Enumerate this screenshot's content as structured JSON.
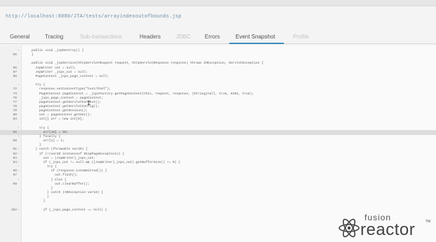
{
  "url": "http://localhost:8080/JTA/tests/arrayindexoutofbounds.jsp",
  "tabs": [
    {
      "label": "General",
      "state": "normal"
    },
    {
      "label": "Tracing",
      "state": "normal"
    },
    {
      "label": "Sub-transactions",
      "state": "disabled"
    },
    {
      "label": "Headers",
      "state": "normal"
    },
    {
      "label": "JDBC",
      "state": "disabled"
    },
    {
      "label": "Errors",
      "state": "normal"
    },
    {
      "label": "Event Snapshot",
      "state": "active"
    },
    {
      "label": "Profile",
      "state": "disabled"
    }
  ],
  "code_lines": [
    {
      "ln": "",
      "fold": "–",
      "text": "    public void _jspDestroy() {"
    },
    {
      "ln": "56",
      "fold": "",
      "text": "    }"
    },
    {
      "ln": "",
      "fold": "",
      "text": ""
    },
    {
      "ln": "",
      "fold": "–",
      "text": "    public void _jspService(HttpServletRequest request, HttpServletResponse response) throws IOException, ServletException {"
    },
    {
      "ln": "65",
      "fold": "",
      "text": "      JspWriter out = null;"
    },
    {
      "ln": "67",
      "fold": "",
      "text": "      JspWriter _jspx_out = null;"
    },
    {
      "ln": "68",
      "fold": "",
      "text": "      PageContext _jspx_page_context = null;"
    },
    {
      "ln": "",
      "fold": "",
      "text": ""
    },
    {
      "ln": "",
      "fold": "–",
      "text": "      try {"
    },
    {
      "ln": "72",
      "fold": "",
      "text": "        response.setContentType(\"text/html\");"
    },
    {
      "ln": "73",
      "fold": "",
      "text": "        PageContext pageContext = _jspxFactory.getPageContext(this, request, response, (String)null, true, 8192, true);"
    },
    {
      "ln": "76",
      "fold": "",
      "text": "        _jspx_page_context = pageContext;"
    },
    {
      "ln": "77",
      "fold": "",
      "text": "        pageContext.getServletContext();"
    },
    {
      "ln": "78",
      "fold": "",
      "text": "        pageContext.getServletConfig();"
    },
    {
      "ln": "79",
      "fold": "",
      "text": "        pageContext.getSession();"
    },
    {
      "ln": "80",
      "fold": "",
      "text": "        out = pageContext.getOut();"
    },
    {
      "ln": "83",
      "fold": "",
      "text": "        int[] arr = new int[5];"
    },
    {
      "ln": "",
      "fold": "",
      "text": ""
    },
    {
      "ln": "",
      "fold": "–",
      "text": "        try {"
    },
    {
      "ln": "86",
      "fold": "",
      "text": "          arr[10] = 50;"
    },
    {
      "ln": "",
      "fold": "–",
      "text": "        } finally {"
    },
    {
      "ln": "88",
      "fold": "",
      "text": "          arr[1] = 1;"
    },
    {
      "ln": "",
      "fold": "",
      "text": "        }"
    },
    {
      "ln": "91",
      "fold": "–",
      "text": "      } catch (Throwable var20) {"
    },
    {
      "ln": "92",
      "fold": "–",
      "text": "        if (!(var20 instanceof SkipPageException)) {"
    },
    {
      "ln": "93",
      "fold": "",
      "text": "          out = (JspWriter)_jspx_out;"
    },
    {
      "ln": "94",
      "fold": "–",
      "text": "          if (_jspx_out != null && ((JspWriter)_jspx_out).getBufferSize() != 0) {"
    },
    {
      "ln": "",
      "fold": "–",
      "text": "            try {"
    },
    {
      "ln": "96",
      "fold": "–",
      "text": "              if (response.isCommitted()) {"
    },
    {
      "ln": "97",
      "fold": "",
      "text": "                out.flush();"
    },
    {
      "ln": "",
      "fold": "–",
      "text": "              } else {"
    },
    {
      "ln": "99",
      "fold": "",
      "text": "                out.clearBuffer();"
    },
    {
      "ln": "",
      "fold": "",
      "text": "              }"
    },
    {
      "ln": "",
      "fold": "–",
      "text": "            } catch (IOException var18) {"
    },
    {
      "ln": "",
      "fold": "",
      "text": "            }"
    },
    {
      "ln": "",
      "fold": "",
      "text": "          }"
    },
    {
      "ln": "",
      "fold": "",
      "text": ""
    },
    {
      "ln": "102",
      "fold": "–",
      "text": "          if (_jspx_page_context == null) {"
    }
  ],
  "highlighted_line_number": "86",
  "logo": {
    "top": "fusion",
    "bottom": "reactor",
    "tm": "TM"
  },
  "colors": {
    "accent": "#3c8dbc",
    "url": "#6a8ea8"
  }
}
